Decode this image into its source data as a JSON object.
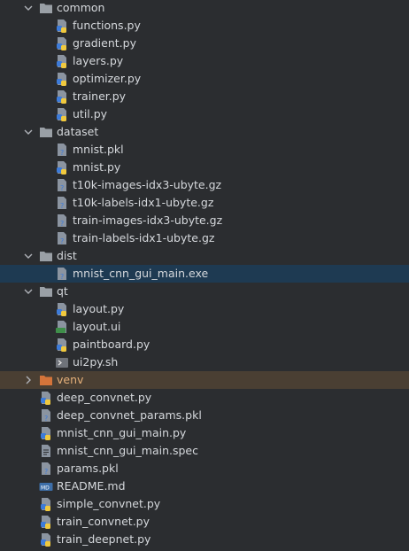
{
  "tree": {
    "folders": {
      "common": {
        "name": "common",
        "files": [
          "functions.py",
          "gradient.py",
          "layers.py",
          "optimizer.py",
          "trainer.py",
          "util.py"
        ]
      },
      "dataset": {
        "name": "dataset",
        "files": [
          "mnist.pkl",
          "mnist.py",
          "t10k-images-idx3-ubyte.gz",
          "t10k-labels-idx1-ubyte.gz",
          "train-images-idx3-ubyte.gz",
          "train-labels-idx1-ubyte.gz"
        ]
      },
      "dist": {
        "name": "dist",
        "files": [
          "mnist_cnn_gui_main.exe"
        ]
      },
      "qt": {
        "name": "qt",
        "files": [
          "layout.py",
          "layout.ui",
          "paintboard.py",
          "ui2py.sh"
        ]
      },
      "venv": {
        "name": "venv"
      }
    },
    "root_files": [
      "deep_convnet.py",
      "deep_convnet_params.pkl",
      "mnist_cnn_gui_main.py",
      "mnist_cnn_gui_main.spec",
      "params.pkl",
      "README.md",
      "simple_convnet.py",
      "train_convnet.py",
      "train_deepnet.py"
    ],
    "colors": {
      "background": "#2b2d30",
      "selected_row": "#1e3a52",
      "excluded_row": "#4a3f33",
      "excluded_folder": "#d4743a",
      "python_blue": "#3d7bd9",
      "python_yellow": "#f0c93e"
    }
  }
}
